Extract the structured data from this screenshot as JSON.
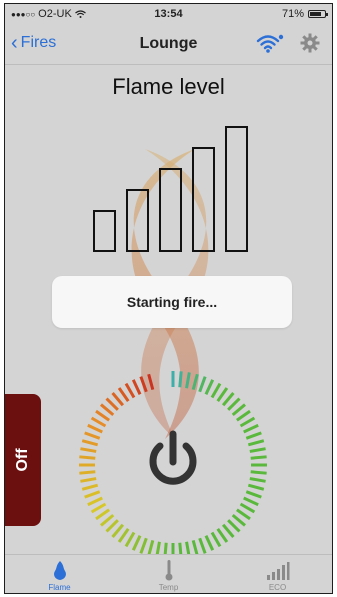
{
  "status_bar": {
    "carrier": "O2-UK",
    "time": "13:54",
    "battery": "71%"
  },
  "nav": {
    "back_label": "Fires",
    "title": "Lounge",
    "wifi_icon": "wifi-icon",
    "settings_icon": "gear-icon",
    "accent": "#2c6fd6"
  },
  "main": {
    "title": "Flame level",
    "flame_levels": 5,
    "status_message": "Starting fire..."
  },
  "side_button": {
    "label": "Off",
    "color": "#6b0f0f"
  },
  "dial": {
    "icon": "power-icon"
  },
  "tabs": [
    {
      "label": "Flame",
      "icon": "rabbit-icon",
      "active": true
    },
    {
      "label": "Temp",
      "icon": "thermometer-icon",
      "active": false
    },
    {
      "label": "ECO",
      "icon": "signal-bars-icon",
      "active": false
    }
  ]
}
